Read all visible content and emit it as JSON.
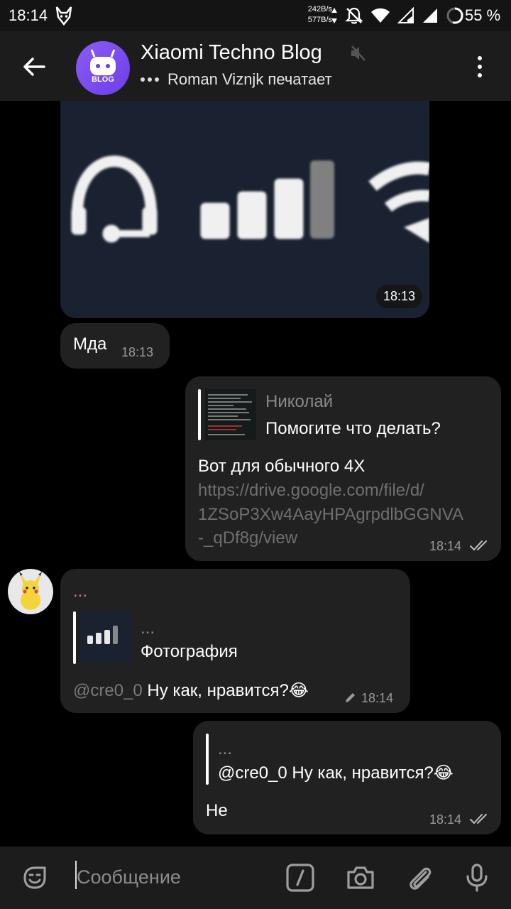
{
  "status_bar": {
    "time": "18:14",
    "speed_up": "242B/s",
    "speed_down": "577B/s",
    "battery": "55 %"
  },
  "header": {
    "title": "Xiaomi Techno Blog",
    "subtitle": "Roman Viznjk печатает",
    "avatar_label": "BLOG"
  },
  "messages": {
    "photo": {
      "time": "18:13"
    },
    "mda": {
      "text": "Мда",
      "time": "18:13"
    },
    "nikolai": {
      "reply_author": "Николай",
      "reply_text": "Помогите что делать?",
      "text": "Вот для обычного 4X",
      "link_line1": "https://drive.google.com/file/d/",
      "link_line2": "1ZSoP3Xw4AayHPAgrpdlbGGNVA",
      "link_line3": "-_qDf8g/view",
      "time": "18:14"
    },
    "incoming": {
      "sender": "...",
      "reply_author": "...",
      "reply_text": "Фотография",
      "mention": "@cre0_0",
      "text": "Ну как, нравится?",
      "emoji": "😂",
      "time": "18:14"
    },
    "outgoing_last": {
      "reply_author": "...",
      "reply_text": "@cre0_0 Ну как, нравится?",
      "emoji": "😂",
      "text": "Не",
      "time": "18:14"
    }
  },
  "input": {
    "placeholder": "Сообщение"
  },
  "colors": {
    "background": "#000000",
    "bubble": "#212121",
    "header": "#1c1c1c",
    "link": "#6f6f6f",
    "accent_purple": "#7b4cf0",
    "sender_red": "#e57373"
  },
  "icons": [
    "back-arrow-icon",
    "mute-icon",
    "more-vert-icon",
    "sticker-icon",
    "slash-command-icon",
    "camera-icon",
    "attach-icon",
    "mic-icon",
    "double-check-icon",
    "pencil-icon"
  ]
}
